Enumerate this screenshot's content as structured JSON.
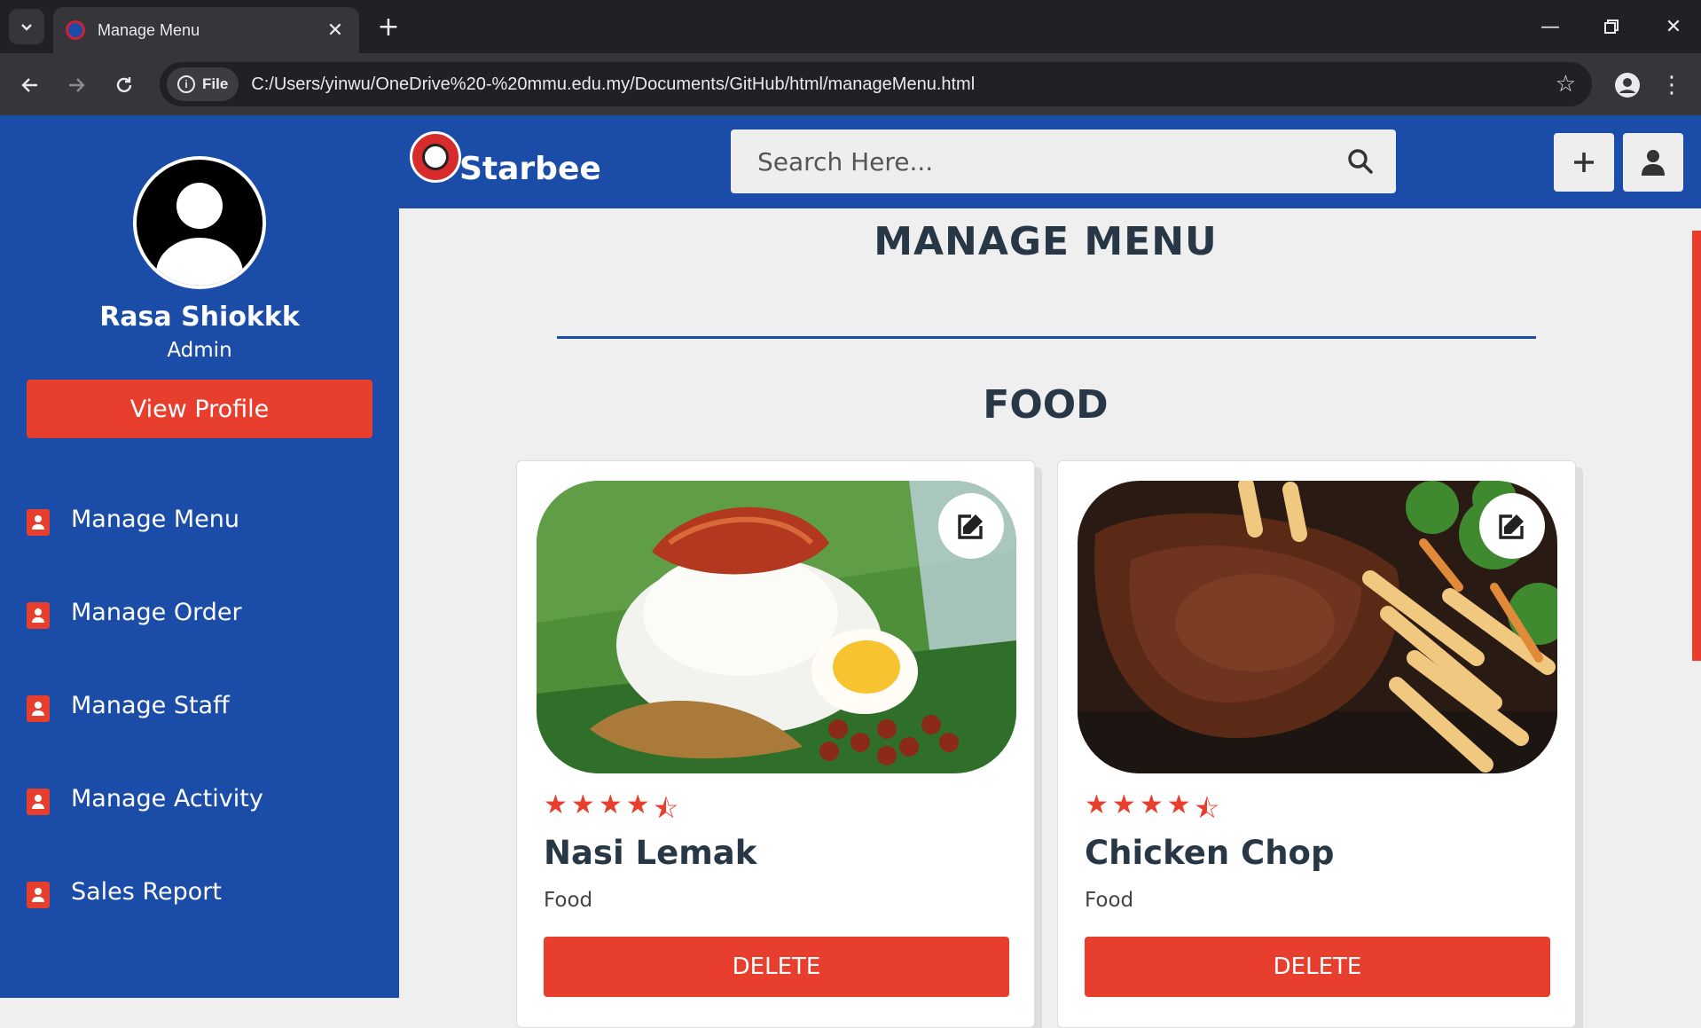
{
  "browser": {
    "tab_title": "Manage Menu",
    "file_chip": "File",
    "url": "C:/Users/yinwu/OneDrive%20-%20mmu.edu.my/Documents/GitHub/html/manageMenu.html"
  },
  "sidebar": {
    "user_name": "Rasa Shiokkk",
    "user_role": "Admin",
    "view_profile": "View Profile",
    "items": [
      {
        "label": "Manage Menu"
      },
      {
        "label": "Manage Order"
      },
      {
        "label": "Manage Staff"
      },
      {
        "label": "Manage Activity"
      },
      {
        "label": "Sales Report"
      }
    ]
  },
  "topbar": {
    "brand": "Starbee",
    "search_placeholder": "Search Here..."
  },
  "main": {
    "title": "MANAGE MENU",
    "section": "FOOD",
    "cards": [
      {
        "name": "Nasi Lemak",
        "category": "Food",
        "rating": 4.5,
        "delete_label": "DELETE"
      },
      {
        "name": "Chicken Chop",
        "category": "Food",
        "rating": 4.5,
        "delete_label": "DELETE"
      }
    ]
  },
  "colors": {
    "primary": "#1a4ca8",
    "accent": "#e83e2e",
    "text_dark": "#283746"
  }
}
